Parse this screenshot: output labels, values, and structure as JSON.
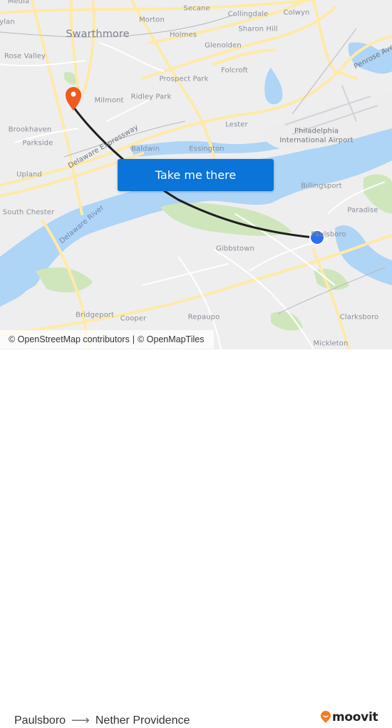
{
  "map": {
    "place_labels": [
      {
        "text": "Media",
        "style": "normal"
      },
      {
        "text": "ylan",
        "style": "normal"
      },
      {
        "text": "Swarthmore",
        "style": "big"
      },
      {
        "text": "Morton",
        "style": "normal"
      },
      {
        "text": "Secane",
        "style": "normal"
      },
      {
        "text": "Collingdale",
        "style": "normal"
      },
      {
        "text": "Colwyn",
        "style": "normal"
      },
      {
        "text": "Holmes",
        "style": "normal"
      },
      {
        "text": "Sharon Hill",
        "style": "normal"
      },
      {
        "text": "Glenolden",
        "style": "normal"
      },
      {
        "text": "Rose Valley",
        "style": "normal"
      },
      {
        "text": "Prospect Park",
        "style": "normal"
      },
      {
        "text": "Folcroft",
        "style": "normal"
      },
      {
        "text": "Penrose Ave",
        "style": "road"
      },
      {
        "text": "Milmont",
        "style": "normal"
      },
      {
        "text": "Ridley Park",
        "style": "normal"
      },
      {
        "text": "Brookhaven",
        "style": "normal"
      },
      {
        "text": "Lester",
        "style": "normal"
      },
      {
        "text": "Philadelphia",
        "style": "dark"
      },
      {
        "text": "International Airport",
        "style": "dark"
      },
      {
        "text": "Parkside",
        "style": "normal"
      },
      {
        "text": "Delaware Expressway",
        "style": "road"
      },
      {
        "text": "Baldwin",
        "style": "normal"
      },
      {
        "text": "Essington",
        "style": "normal"
      },
      {
        "text": "Upland",
        "style": "normal"
      },
      {
        "text": "Billingsport",
        "style": "normal"
      },
      {
        "text": "South Chester",
        "style": "normal"
      },
      {
        "text": "Delaware River",
        "style": "water"
      },
      {
        "text": "Paradise",
        "style": "normal"
      },
      {
        "text": "Paulsboro",
        "style": "normal"
      },
      {
        "text": "Gibbstown",
        "style": "normal"
      },
      {
        "text": "Bridgeport",
        "style": "normal"
      },
      {
        "text": "Cooper",
        "style": "normal"
      },
      {
        "text": "Repaupo",
        "style": "normal"
      },
      {
        "text": "Clarksboro",
        "style": "normal"
      },
      {
        "text": "Mickleton",
        "style": "normal"
      }
    ],
    "origin_marker": {
      "name": "Paulsboro",
      "color": "#2d6ff0"
    },
    "destination_marker": {
      "name": "Nether Providence",
      "color": "#f05a1e"
    },
    "route_color": "#1f1f1f",
    "water_color": "#aed4f6",
    "park_color": "#cfe6bd",
    "road_color": "#fdeaa8",
    "cta_button": {
      "label": "Take me there",
      "color": "#0a74d8"
    },
    "attribution": {
      "osm": "© OpenStreetMap contributors",
      "separator": "|",
      "omt": "© OpenMapTiles"
    }
  },
  "footer": {
    "origin": "Paulsboro",
    "arrow": "⟶",
    "destination": "Nether Providence",
    "brand": "moovit",
    "brand_color": "#f47b20"
  }
}
